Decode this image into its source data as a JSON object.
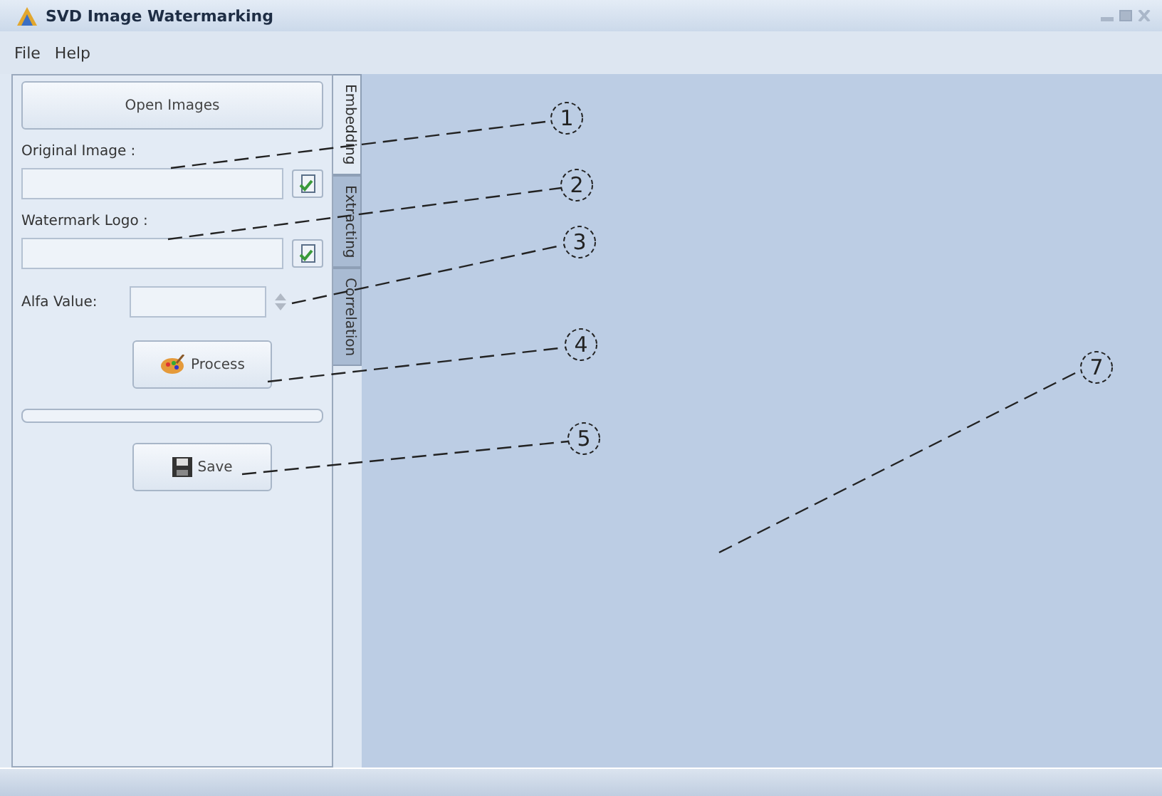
{
  "window": {
    "title": "SVD Image Watermarking"
  },
  "menu": [
    "File",
    "Help"
  ],
  "tabs": [
    {
      "label": "Embedding",
      "selected": true
    },
    {
      "label": "Extracting",
      "selected": false
    },
    {
      "label": "Correlation",
      "selected": false
    }
  ],
  "panel": {
    "open_button": "Open Images",
    "original_label": "Original Image :",
    "logo_label": "Watermark Logo :",
    "alfa_label": "Alfa Value:",
    "process_button": "Process",
    "save_button": "Save"
  },
  "callouts": [
    "1",
    "2",
    "3",
    "4",
    "5",
    "7"
  ]
}
